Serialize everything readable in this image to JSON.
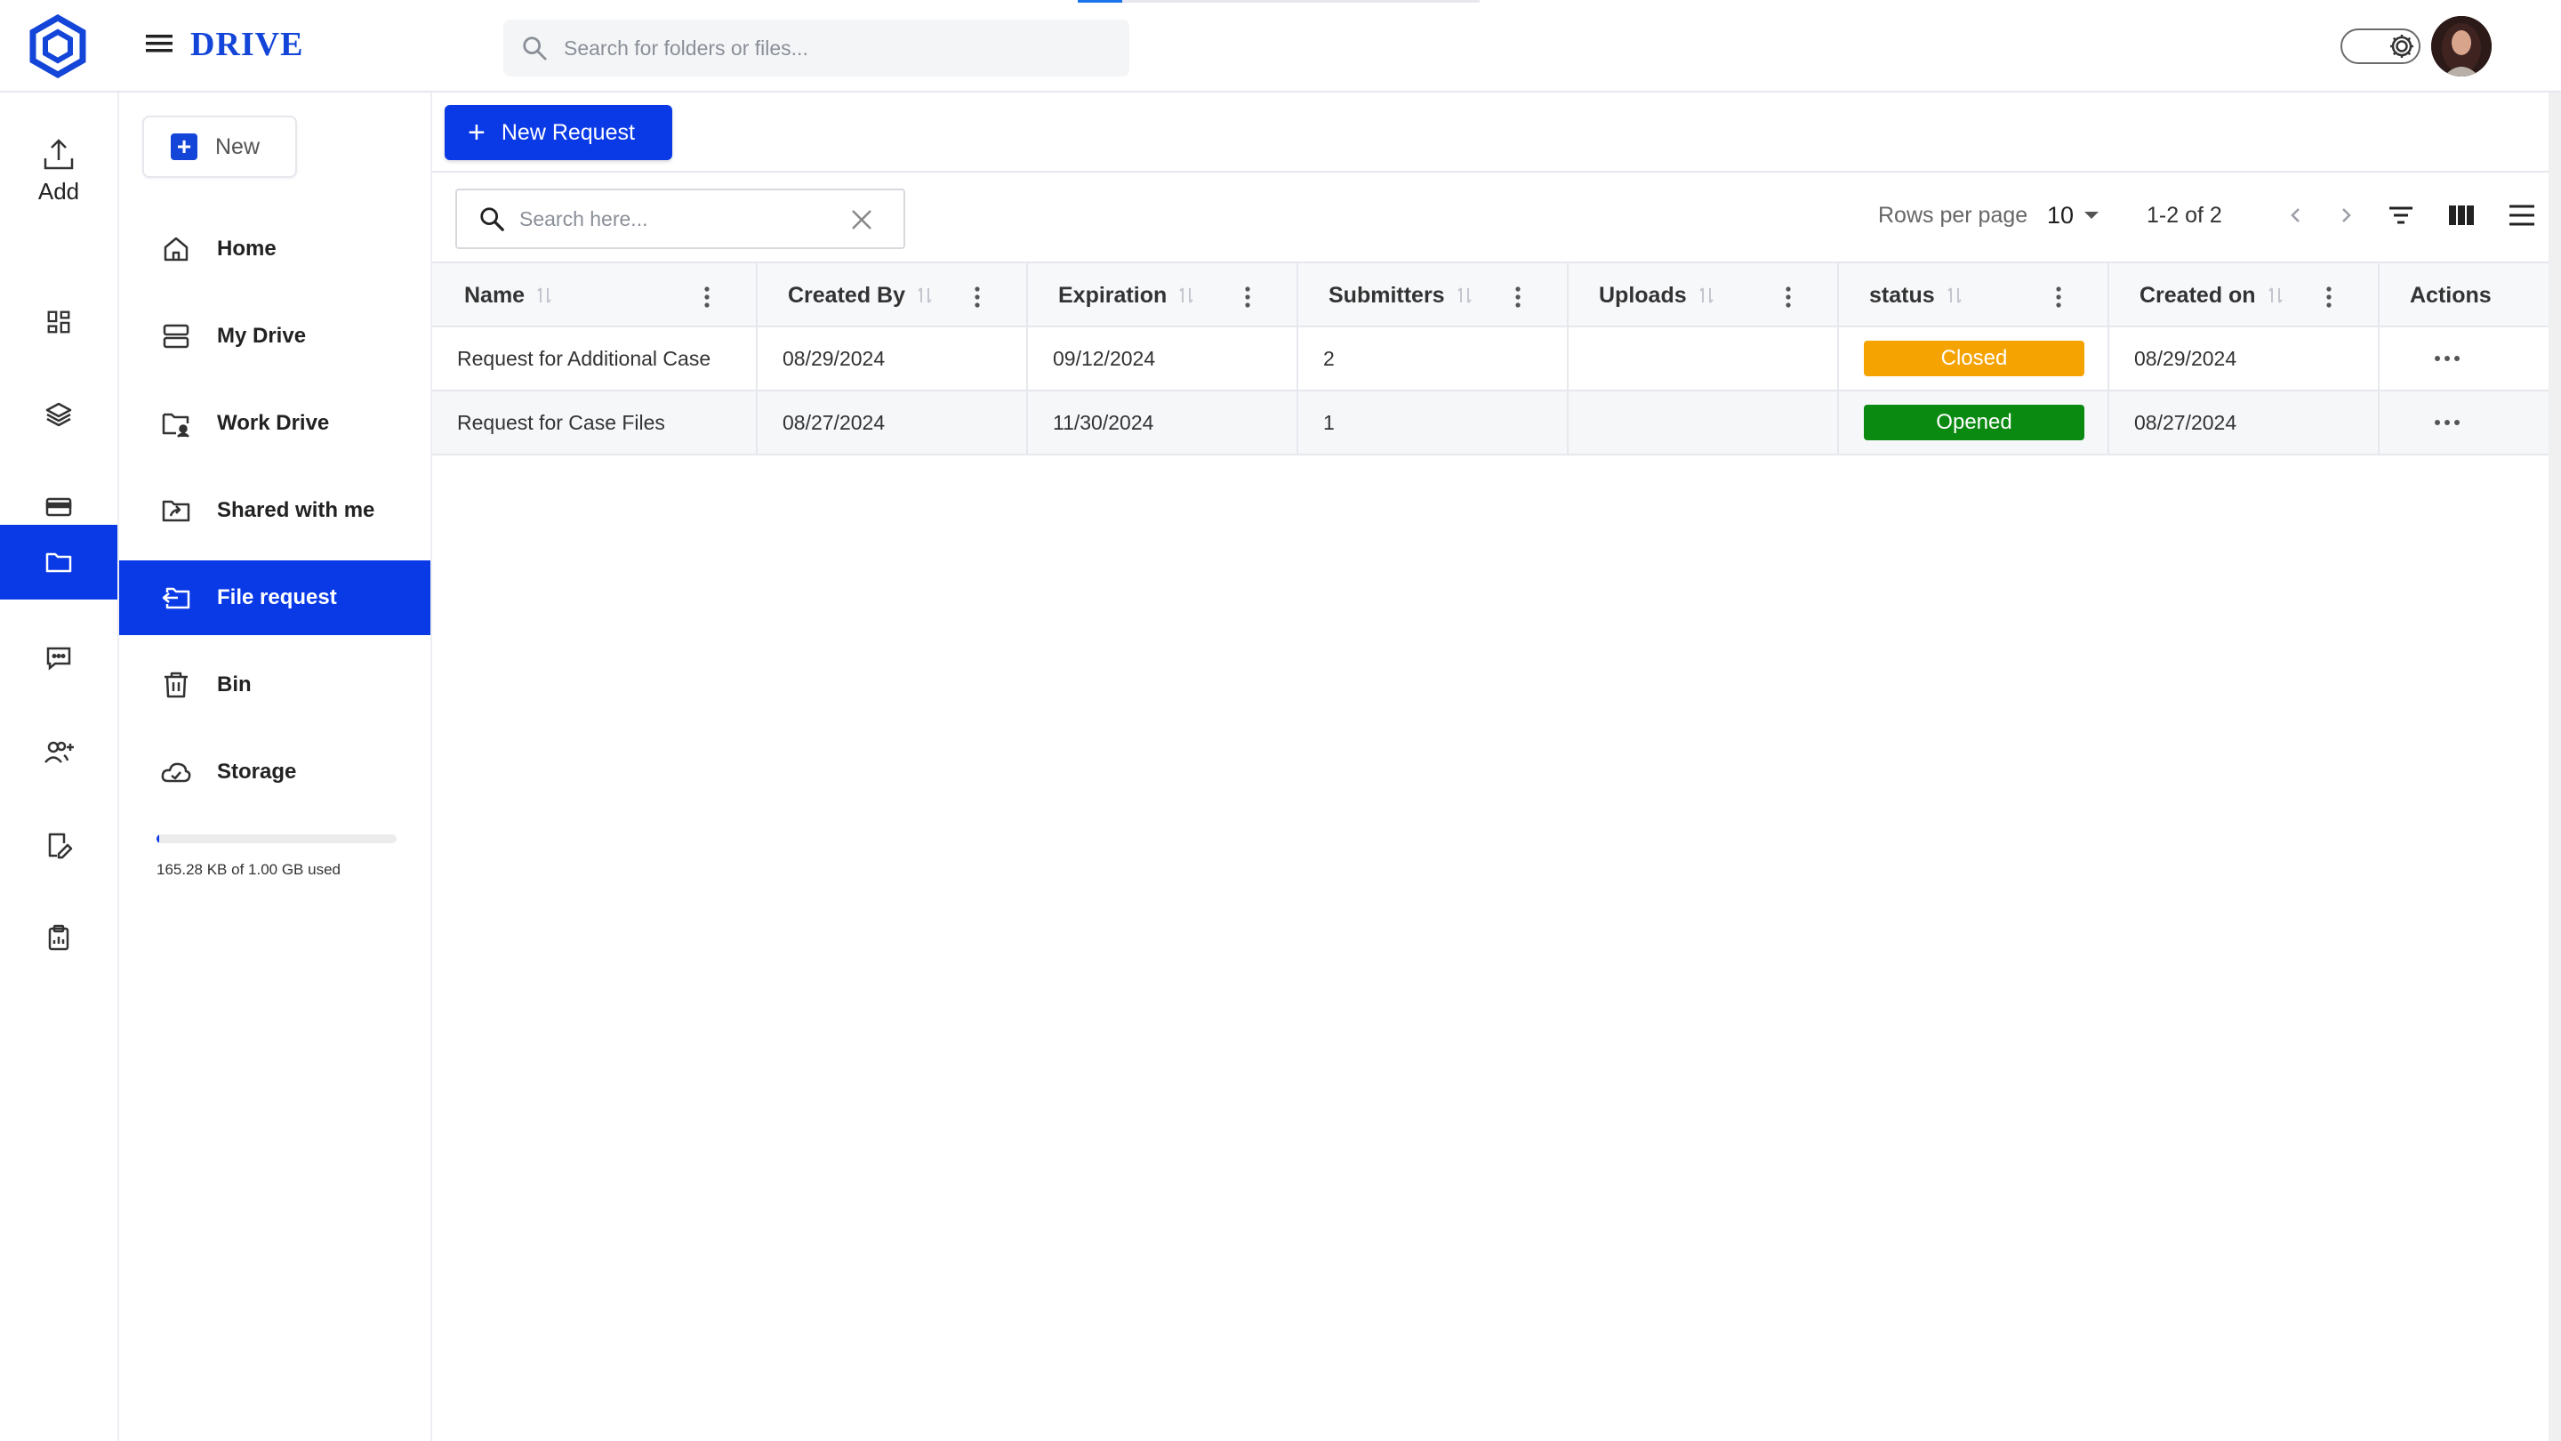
{
  "app": {
    "brand": "DRIVE",
    "search_placeholder": "Search for folders or files..."
  },
  "header": {
    "progress": 0.11,
    "icons": [
      "logo-icon",
      "hamburger-icon",
      "search-icon",
      "settings-gear-icon",
      "avatar"
    ]
  },
  "rail": {
    "add_label": "Add",
    "items": [
      "dashboard-icon",
      "layers-icon",
      "card-icon",
      "folder-icon",
      "chat-icon",
      "user-add-icon",
      "edit-document-icon",
      "clipboard-icon"
    ],
    "active_index": 3
  },
  "nav": {
    "new_label": "New",
    "items": [
      {
        "label": "Home",
        "icon": "home-icon"
      },
      {
        "label": "My Drive",
        "icon": "drive-icon"
      },
      {
        "label": "Work Drive",
        "icon": "work-folder-icon"
      },
      {
        "label": "Shared with me",
        "icon": "shared-folder-icon"
      },
      {
        "label": "File request",
        "icon": "file-request-icon"
      },
      {
        "label": "Bin",
        "icon": "bin-icon"
      },
      {
        "label": "Storage",
        "icon": "cloud-icon"
      }
    ],
    "active_index": 4,
    "storage_used_fraction": 0.0002,
    "storage_text": "165.28 KB of 1.00 GB used"
  },
  "main": {
    "new_request_label": "New Request",
    "search_placeholder": "Search here...",
    "rows_per_page_label": "Rows per page",
    "rows_per_page_value": "10",
    "page_range": "1-2 of 2",
    "columns": [
      "Name",
      "Created By",
      "Expiration",
      "Submitters",
      "Uploads",
      "status",
      "Created on",
      "Actions"
    ],
    "rows": [
      {
        "name": "Request for Additional Case",
        "created_by": "08/29/2024",
        "expiration": "09/12/2024",
        "submitters": "2",
        "uploads": "",
        "status": "Closed",
        "status_color": "#f5a300",
        "created_on": "08/29/2024"
      },
      {
        "name": "Request for Case Files",
        "created_by": "08/27/2024",
        "expiration": "11/30/2024",
        "submitters": "1",
        "uploads": "",
        "status": "Opened",
        "status_color": "#0b8a12",
        "created_on": "08/27/2024"
      }
    ]
  },
  "colors": {
    "accent": "#0a39e6",
    "brand": "#1345d8"
  }
}
